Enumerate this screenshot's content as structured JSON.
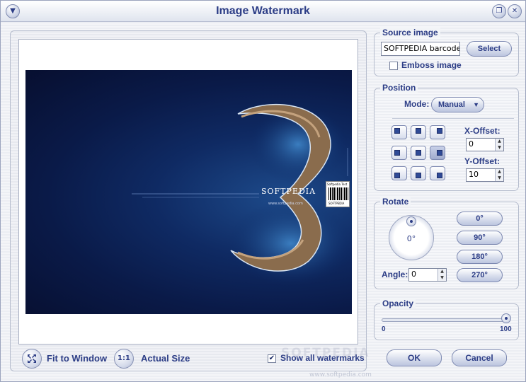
{
  "window": {
    "title": "Image Watermark"
  },
  "preview": {
    "image_wordmark": "SOFTPEDIA",
    "image_url_text": "www.softpedia.com",
    "barcode_top": "Softpedia Test",
    "barcode_bottom": "SOFTPEDIA"
  },
  "bottom": {
    "fit_icon": "fit-to-window-icon",
    "fit_label": "Fit to Window",
    "actual_icon_text": "1:1",
    "actual_label": "Actual Size",
    "show_all_label": "Show all watermarks",
    "show_all_checked": true
  },
  "source": {
    "title": "Source image",
    "file_value": "SOFTPEDIA barcode.",
    "select_label": "Select",
    "emboss_label": "Emboss image",
    "emboss_checked": false
  },
  "position": {
    "title": "Position",
    "mode_label": "Mode:",
    "mode_value": "Manual",
    "x_label": "X-Offset:",
    "x_value": "0",
    "y_label": "Y-Offset:",
    "y_value": "10",
    "active_cell": "middle-right"
  },
  "rotate": {
    "title": "Rotate",
    "dial_value": "0°",
    "angle_label": "Angle:",
    "angle_value": "0",
    "presets": [
      "0°",
      "90°",
      "180°",
      "270°"
    ]
  },
  "opacity": {
    "title": "Opacity",
    "min": "0",
    "max": "100",
    "value": 100
  },
  "actions": {
    "ok_label": "OK",
    "cancel_label": "Cancel"
  },
  "footer": {
    "watermark": "SOFTPEDIA",
    "url": "www.softpedia.com"
  }
}
